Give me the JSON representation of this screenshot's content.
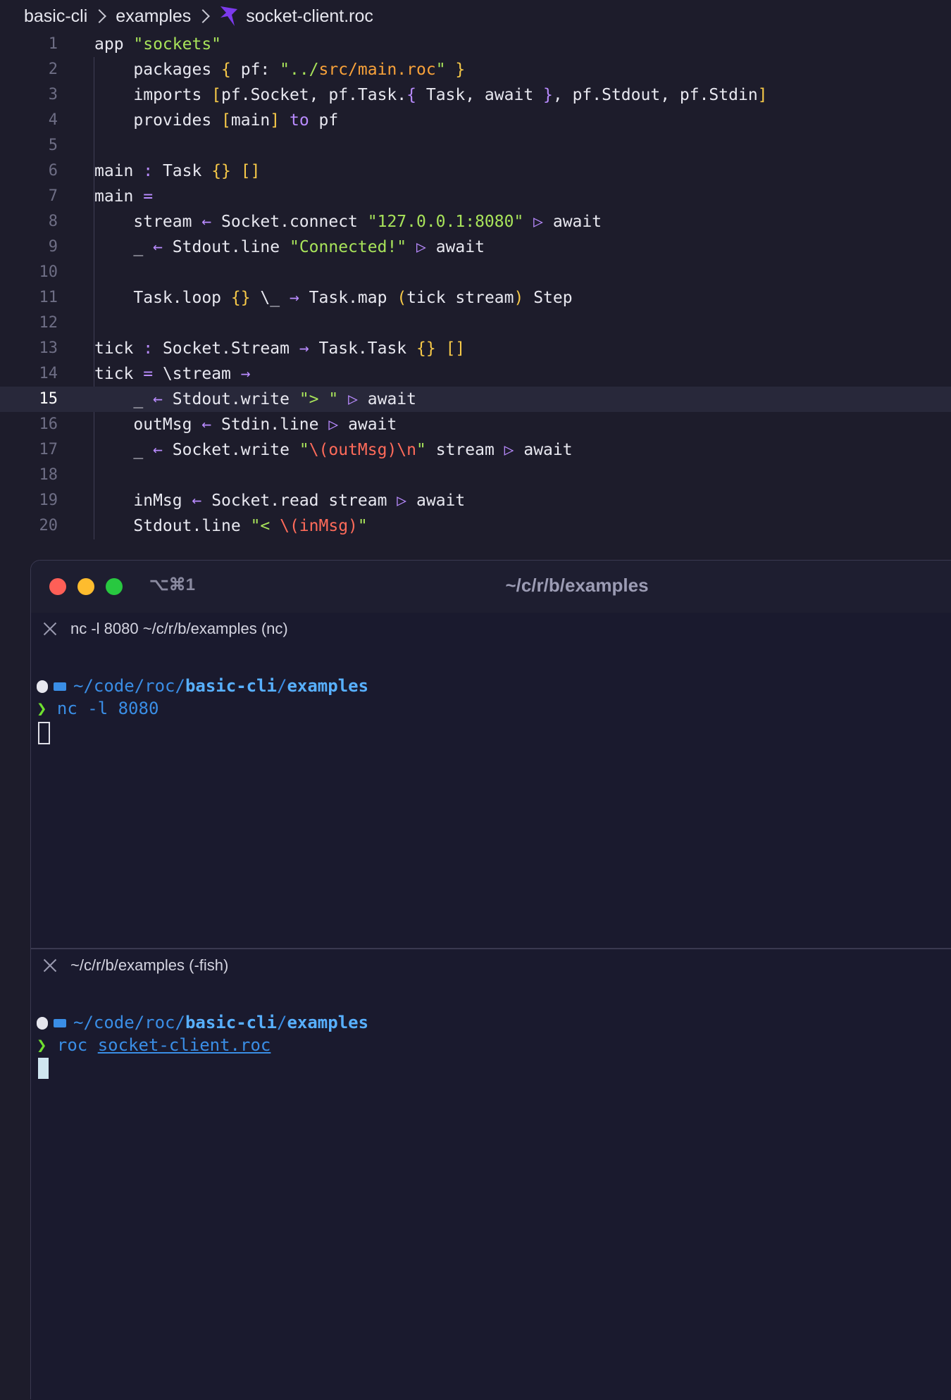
{
  "breadcrumb": {
    "segments": [
      "basic-cli",
      "examples"
    ],
    "file": "socket-client.roc"
  },
  "editor": {
    "current_line": 15,
    "lines": [
      [
        {
          "t": "app ",
          "c": "plain"
        },
        {
          "t": "\"sockets\"",
          "c": "str"
        }
      ],
      [
        {
          "t": "    packages ",
          "c": "plain"
        },
        {
          "t": "{",
          "c": "br"
        },
        {
          "t": " pf: ",
          "c": "plain"
        },
        {
          "t": "\"../",
          "c": "str"
        },
        {
          "t": "src/main.roc",
          "c": "path"
        },
        {
          "t": "\"",
          "c": "str"
        },
        {
          "t": " }",
          "c": "br"
        }
      ],
      [
        {
          "t": "    imports ",
          "c": "plain"
        },
        {
          "t": "[",
          "c": "br"
        },
        {
          "t": "pf.Socket, pf.Task.",
          "c": "plain"
        },
        {
          "t": "{",
          "c": "kw"
        },
        {
          "t": " Task, await ",
          "c": "plain"
        },
        {
          "t": "}",
          "c": "kw"
        },
        {
          "t": ", pf.Stdout, pf.Stdin",
          "c": "plain"
        },
        {
          "t": "]",
          "c": "br"
        }
      ],
      [
        {
          "t": "    provides ",
          "c": "plain"
        },
        {
          "t": "[",
          "c": "br"
        },
        {
          "t": "main",
          "c": "plain"
        },
        {
          "t": "]",
          "c": "br"
        },
        {
          "t": " to ",
          "c": "kw"
        },
        {
          "t": "pf",
          "c": "plain"
        }
      ],
      [],
      [
        {
          "t": "main ",
          "c": "plain"
        },
        {
          "t": ":",
          "c": "kw"
        },
        {
          "t": " Task ",
          "c": "plain"
        },
        {
          "t": "{}",
          "c": "br"
        },
        {
          "t": " ",
          "c": "plain"
        },
        {
          "t": "[]",
          "c": "br"
        }
      ],
      [
        {
          "t": "main ",
          "c": "plain"
        },
        {
          "t": "=",
          "c": "kw"
        }
      ],
      [
        {
          "t": "    stream ",
          "c": "plain"
        },
        {
          "t": "←",
          "c": "kw"
        },
        {
          "t": " Socket.connect ",
          "c": "plain"
        },
        {
          "t": "\"127.0.0.1:8080\"",
          "c": "str"
        },
        {
          "t": " ▷",
          "c": "op"
        },
        {
          "t": " await",
          "c": "plain"
        }
      ],
      [
        {
          "t": "    _ ",
          "c": "plain"
        },
        {
          "t": "←",
          "c": "kw"
        },
        {
          "t": " Stdout.line ",
          "c": "plain"
        },
        {
          "t": "\"Connected!\"",
          "c": "str"
        },
        {
          "t": " ▷",
          "c": "op"
        },
        {
          "t": " await",
          "c": "plain"
        }
      ],
      [],
      [
        {
          "t": "    Task.loop ",
          "c": "plain"
        },
        {
          "t": "{}",
          "c": "br"
        },
        {
          "t": " \\_ ",
          "c": "plain"
        },
        {
          "t": "→",
          "c": "kw"
        },
        {
          "t": " Task.map ",
          "c": "plain"
        },
        {
          "t": "(",
          "c": "br"
        },
        {
          "t": "tick stream",
          "c": "plain"
        },
        {
          "t": ")",
          "c": "br"
        },
        {
          "t": " Step",
          "c": "plain"
        }
      ],
      [],
      [
        {
          "t": "tick ",
          "c": "plain"
        },
        {
          "t": ":",
          "c": "kw"
        },
        {
          "t": " Socket.Stream ",
          "c": "plain"
        },
        {
          "t": "→",
          "c": "kw"
        },
        {
          "t": " Task.Task ",
          "c": "plain"
        },
        {
          "t": "{}",
          "c": "br"
        },
        {
          "t": " ",
          "c": "plain"
        },
        {
          "t": "[]",
          "c": "br"
        }
      ],
      [
        {
          "t": "tick ",
          "c": "plain"
        },
        {
          "t": "=",
          "c": "kw"
        },
        {
          "t": " \\stream ",
          "c": "plain"
        },
        {
          "t": "→",
          "c": "kw"
        }
      ],
      [
        {
          "t": "    _ ",
          "c": "plain"
        },
        {
          "t": "←",
          "c": "kw"
        },
        {
          "t": " Stdout.write ",
          "c": "plain"
        },
        {
          "t": "\"> \"",
          "c": "str"
        },
        {
          "t": " ▷",
          "c": "op"
        },
        {
          "t": " await",
          "c": "plain"
        }
      ],
      [
        {
          "t": "    outMsg ",
          "c": "plain"
        },
        {
          "t": "←",
          "c": "kw"
        },
        {
          "t": " Stdin.line ",
          "c": "plain"
        },
        {
          "t": "▷",
          "c": "op"
        },
        {
          "t": " await",
          "c": "plain"
        }
      ],
      [
        {
          "t": "    _ ",
          "c": "plain"
        },
        {
          "t": "←",
          "c": "kw"
        },
        {
          "t": " Socket.write ",
          "c": "plain"
        },
        {
          "t": "\"",
          "c": "str"
        },
        {
          "t": "\\(outMsg)\\n",
          "c": "esc"
        },
        {
          "t": "\"",
          "c": "str"
        },
        {
          "t": " stream ",
          "c": "plain"
        },
        {
          "t": "▷",
          "c": "op"
        },
        {
          "t": " await",
          "c": "plain"
        }
      ],
      [],
      [
        {
          "t": "    inMsg ",
          "c": "plain"
        },
        {
          "t": "←",
          "c": "kw"
        },
        {
          "t": " Socket.read stream ",
          "c": "plain"
        },
        {
          "t": "▷",
          "c": "op"
        },
        {
          "t": " await",
          "c": "plain"
        }
      ],
      [
        {
          "t": "    Stdout.line ",
          "c": "plain"
        },
        {
          "t": "\"< ",
          "c": "str"
        },
        {
          "t": "\\(inMsg)",
          "c": "esc"
        },
        {
          "t": "\"",
          "c": "str"
        }
      ]
    ]
  },
  "terminal": {
    "shortcut": "⌥⌘1",
    "title": "~/c/r/b/examples",
    "panes": [
      {
        "header": "nc -l 8080 ~/c/r/b/examples (nc)",
        "path_prefix": "~/code/roc/",
        "path_bold": "basic-cli",
        "path_sep": "/",
        "path_bold2": "examples",
        "prompt": "❯",
        "command": "nc -l 8080"
      },
      {
        "header": "~/c/r/b/examples (-fish)",
        "path_prefix": "~/code/roc/",
        "path_bold": "basic-cli",
        "path_sep": "/",
        "path_bold2": "examples",
        "prompt": "❯",
        "command": "roc",
        "command_arg": "socket-client.roc"
      }
    ]
  },
  "colors": {
    "background": "#1d1c2b",
    "string": "#a8e35a",
    "keyword": "#b98bff",
    "bracket": "#f7c948",
    "escape": "#ff6b5a",
    "path_blue": "#3a8ee6",
    "prompt_green": "#6fe02f"
  }
}
